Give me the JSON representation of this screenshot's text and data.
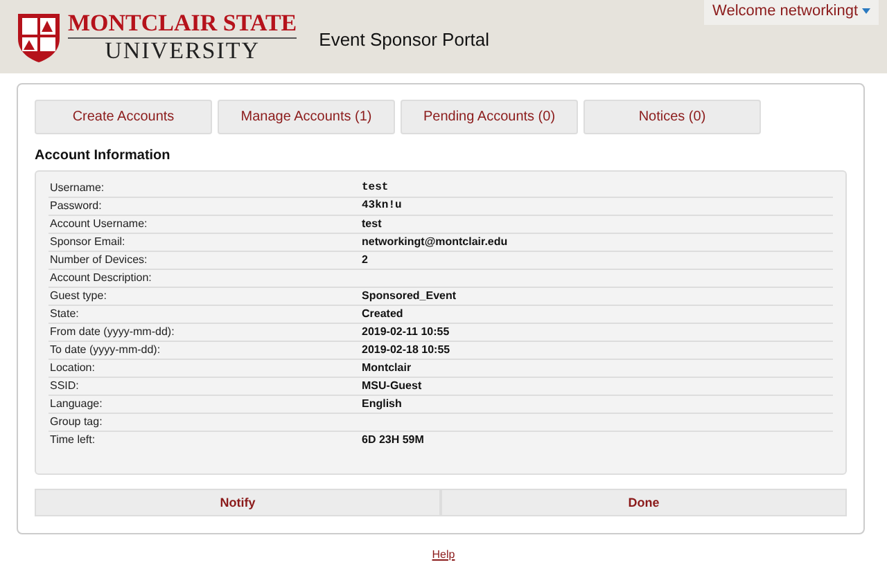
{
  "header": {
    "logo_top": "MONTCLAIR STATE",
    "logo_bottom": "UNIVERSITY",
    "title": "Event Sponsor Portal",
    "user_menu": "Welcome networkingt"
  },
  "tabs": [
    {
      "label": "Create Accounts"
    },
    {
      "label": "Manage Accounts (1)"
    },
    {
      "label": "Pending Accounts (0)"
    },
    {
      "label": "Notices (0)"
    }
  ],
  "section_title": "Account Information",
  "rows": [
    {
      "label": "Username:",
      "value": "test",
      "kind": "mono"
    },
    {
      "label": "Password:",
      "value": "43kn!u",
      "kind": "mono"
    },
    {
      "label": "Account Username:",
      "value": "test",
      "kind": "bold"
    },
    {
      "label": "Sponsor Email:",
      "value": "networkingt@montclair.edu",
      "kind": "bold"
    },
    {
      "label": "Number of Devices:",
      "value": "2",
      "kind": "bold"
    },
    {
      "label": "Account Description:"
    },
    {
      "label": "Guest type:",
      "value": "Sponsored_Event",
      "kind": "bold"
    },
    {
      "label": "State:",
      "value": "Created",
      "kind": "bold"
    },
    {
      "label": "From date (yyyy-mm-dd):",
      "value": "2019-02-11 10:55",
      "kind": "bold"
    },
    {
      "label": "To date (yyyy-mm-dd):",
      "value": "2019-02-18 10:55",
      "kind": "bold"
    },
    {
      "label": "Location:",
      "value": "Montclair",
      "kind": "bold"
    },
    {
      "label": "SSID:",
      "value": "MSU-Guest",
      "kind": "bold"
    },
    {
      "label": "Language:",
      "value": "English",
      "kind": "bold"
    },
    {
      "label": "Group tag:"
    },
    {
      "label": "Time left:",
      "value": "6D 23H 59M",
      "kind": "bold"
    }
  ],
  "buttons": [
    "Notify",
    "Done"
  ],
  "footer_link": "Help"
}
